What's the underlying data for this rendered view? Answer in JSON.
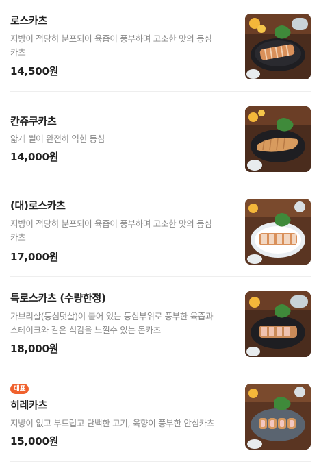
{
  "menu": {
    "items": [
      {
        "name": "로스카츠",
        "desc_lines": [
          "지방이 적당히 분포되어 육즙이 풍부하며 고소한 맛의 등심",
          "카츠"
        ],
        "price": "14,500원",
        "badge": null,
        "image_icon": "pork-cutlet-photo"
      },
      {
        "name": "칸쥬쿠카츠",
        "desc_lines": [
          "얇게 썰어 완전히 익힌 등심"
        ],
        "price": "14,000원",
        "badge": null,
        "image_icon": "pork-cutlet-photo"
      },
      {
        "name": "(대)로스카츠",
        "desc_lines": [
          "지방이 적당히 분포되어 육즙이 풍부하며 고소한 맛의 등심",
          "카츠"
        ],
        "price": "17,000원",
        "badge": null,
        "image_icon": "pork-cutlet-photo"
      },
      {
        "name": "특로스카츠 (수량한정)",
        "desc_lines": [
          "가브리살(등심덧살)이 붙어 있는 등심부위로 풍부한 육즙과",
          "스테이크와 같은 식감을 느낄수 있는 돈카츠"
        ],
        "price": "18,000원",
        "badge": null,
        "image_icon": "pork-cutlet-photo"
      },
      {
        "name": "히레카츠",
        "desc_lines": [
          "지방이 없고 부드럽고 단백한 고기, 육향이 풍부한 안심카츠"
        ],
        "price": "15,000원",
        "badge": "대표",
        "image_icon": "pork-cutlet-photo"
      }
    ]
  },
  "colors": {
    "badge": "#f0612d",
    "name": "#222222",
    "desc": "#8a8a8a",
    "divider": "#eeeeee"
  }
}
